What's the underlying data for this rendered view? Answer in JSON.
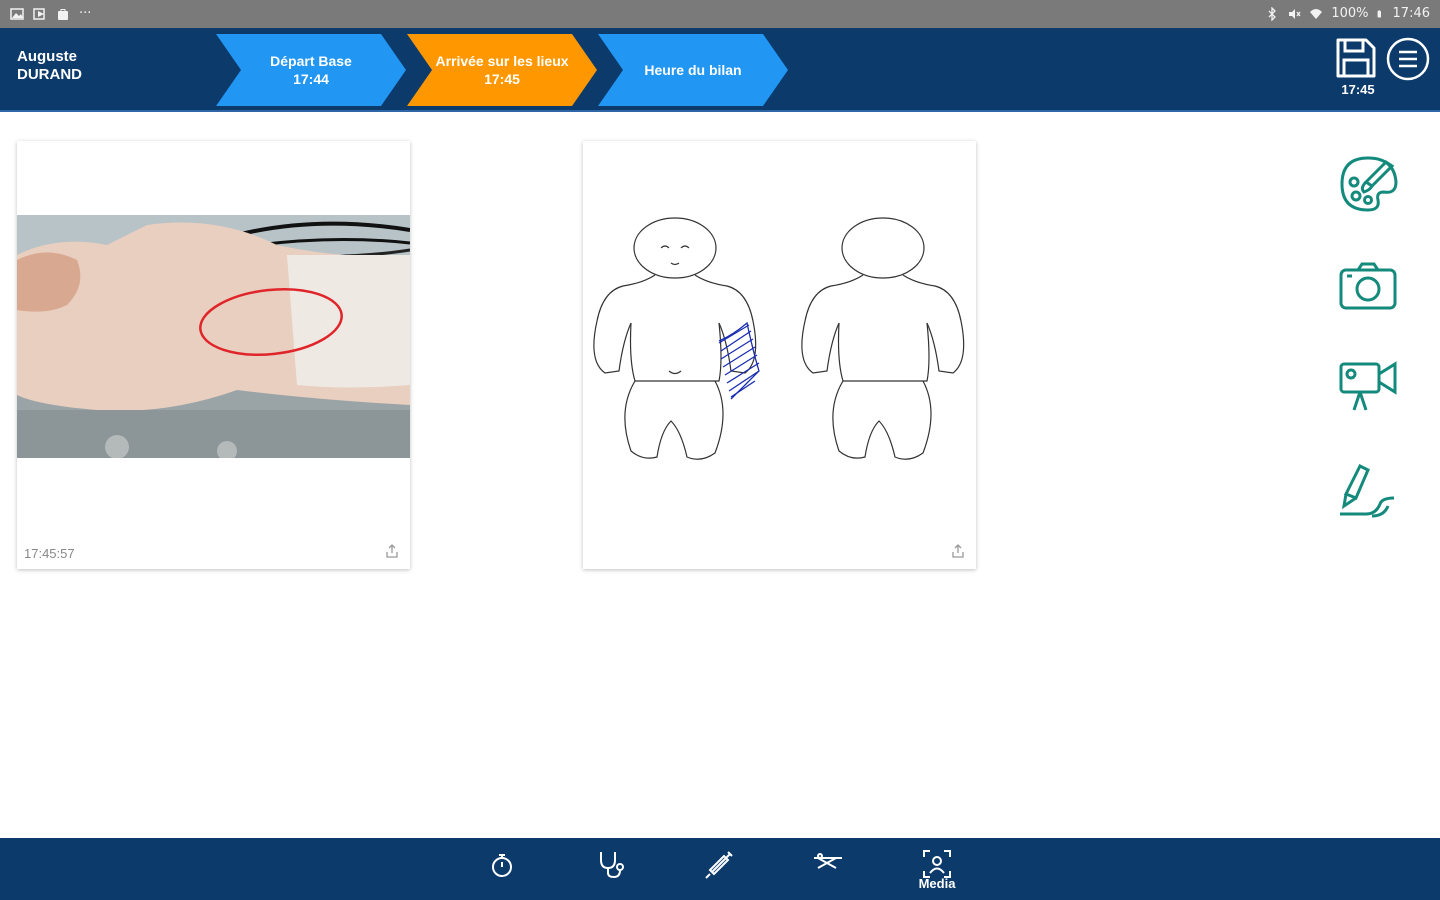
{
  "status_bar": {
    "battery": "100%",
    "time": "17:46"
  },
  "header": {
    "patient_first_name": "Auguste",
    "patient_last_name": "DURAND",
    "steps": [
      {
        "label": "Départ Base",
        "time": "17:44",
        "color": "#2196f3"
      },
      {
        "label": "Arrivée sur les lieux",
        "time": "17:45",
        "color": "#ff9800"
      },
      {
        "label": "Heure du bilan",
        "time": "",
        "color": "#2196f3"
      }
    ],
    "save_time": "17:45"
  },
  "media": {
    "photo_card": {
      "timestamp": "17:45:57",
      "icon": "share-icon"
    },
    "bodymap_card": {
      "icon": "share-icon"
    }
  },
  "actions": [
    {
      "name": "palette-icon"
    },
    {
      "name": "camera-icon"
    },
    {
      "name": "video-camera-icon"
    },
    {
      "name": "signature-icon"
    }
  ],
  "bottom_nav": {
    "items": [
      {
        "name": "stopwatch-icon",
        "label": ""
      },
      {
        "name": "stethoscope-icon",
        "label": ""
      },
      {
        "name": "syringe-icon",
        "label": ""
      },
      {
        "name": "stretcher-icon",
        "label": ""
      },
      {
        "name": "media-icon",
        "label": "Media"
      }
    ]
  },
  "colors": {
    "primary": "#0b3a6b",
    "step_blue": "#2196f3",
    "step_orange": "#ff9800",
    "action_teal": "#138a7c"
  }
}
